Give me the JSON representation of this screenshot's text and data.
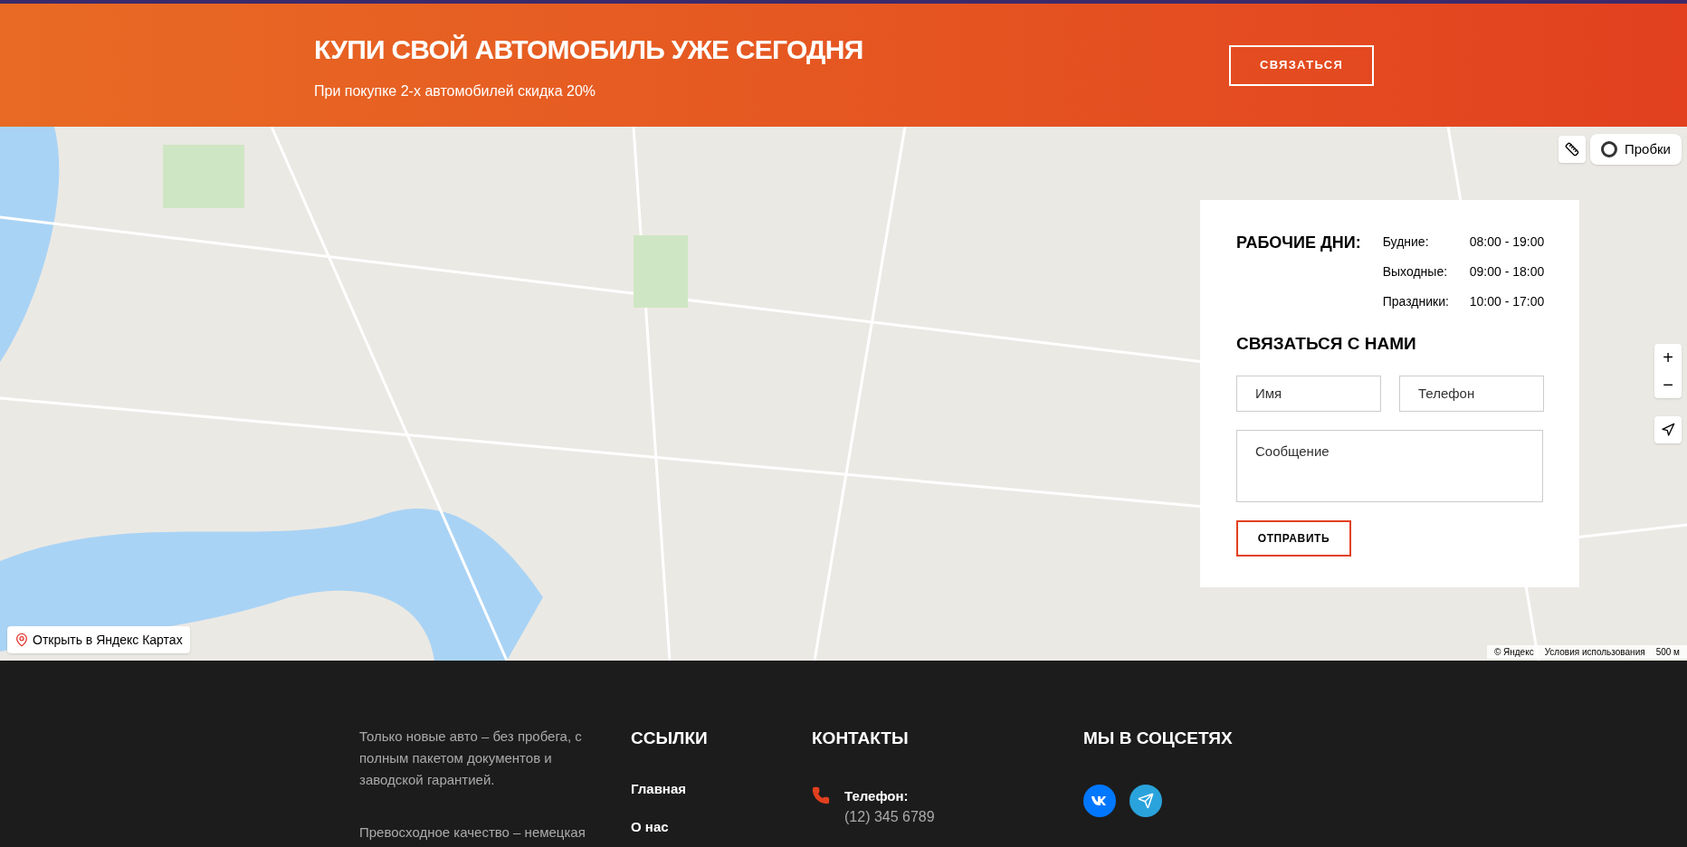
{
  "promo": {
    "title": "КУПИ СВОЙ АВТОМОБИЛЬ УЖЕ СЕГОДНЯ",
    "subtitle": "При покупке 2-х автомобилей скидка 20%",
    "button": "СВЯЗАТЬСЯ"
  },
  "map": {
    "traffic_button": "Пробки",
    "open_link": "Открыть в Яндекс Картах",
    "zoom_in": "+",
    "zoom_out": "−",
    "copyright": "© Яндекс",
    "terms": "Условия использования",
    "scale": "500 м"
  },
  "contact_card": {
    "hours_title": "РАБОЧИЕ ДНИ:",
    "hours": [
      {
        "label": "Будние:",
        "time": "08:00 - 19:00"
      },
      {
        "label": "Выходные:",
        "time": "09:00 - 18:00"
      },
      {
        "label": "Праздники:",
        "time": "10:00 - 17:00"
      }
    ],
    "form_title": "СВЯЗАТЬСЯ С НАМИ",
    "name_placeholder": "Имя",
    "phone_placeholder": "Телефон",
    "message_placeholder": "Сообщение",
    "submit": "ОТПРАВИТЬ"
  },
  "footer": {
    "about": [
      "Только новые авто – без пробега, с полным пакетом документов и заводской гарантией.",
      "Превосходное качество – немецкая"
    ],
    "links_title": "ССЫЛКИ",
    "links": [
      "Главная",
      "О нас"
    ],
    "contacts_title": "КОНТАКТЫ",
    "phone_label": "Телефон:",
    "phone": "(12) 345 6789",
    "social_title": "МЫ В СОЦСЕТЯХ",
    "socials": [
      {
        "kind": "vk",
        "color": "#0077ff"
      },
      {
        "kind": "telegram",
        "color": "#2aa3dc"
      }
    ]
  }
}
